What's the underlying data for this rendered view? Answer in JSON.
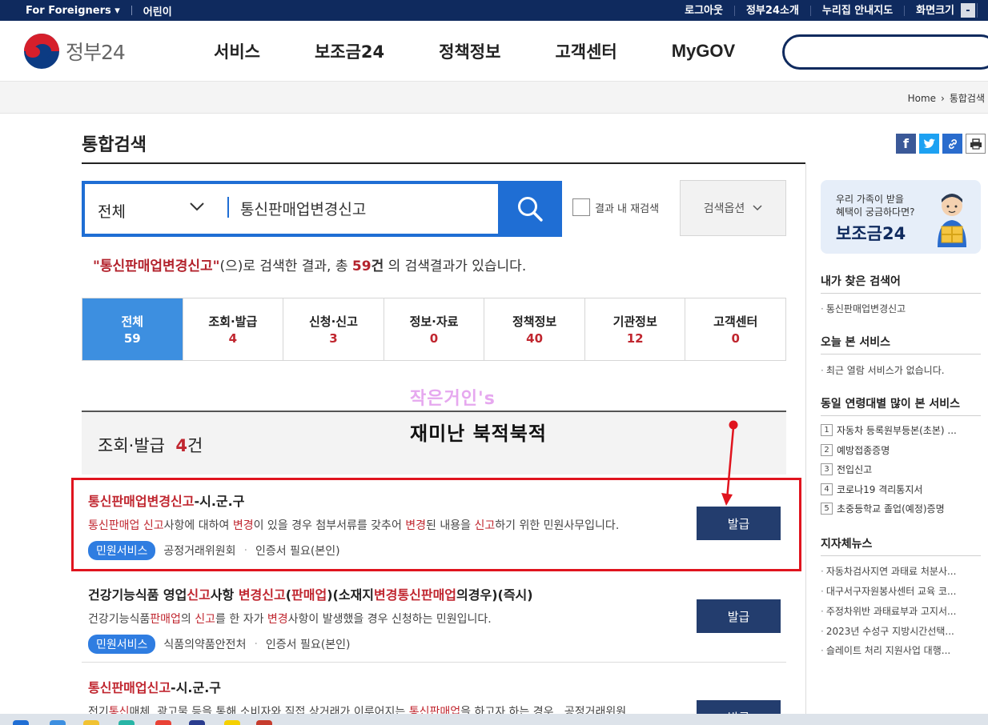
{
  "utility": {
    "for_foreigners": "For Foreigners",
    "kids": "어린이",
    "logout": "로그아웃",
    "about": "정부24소개",
    "sitemap": "누리집 안내지도",
    "fontsize": "화면크기",
    "minus": "-"
  },
  "header": {
    "logo_text": "정부24",
    "nav": [
      "서비스",
      "보조금24",
      "정책정보",
      "고객센터",
      "MyGOV"
    ]
  },
  "breadcrumb": {
    "home": "Home",
    "current": "통합검색"
  },
  "page": {
    "title": "통합검색"
  },
  "search": {
    "scope": "전체",
    "query": "통신판매업변경신고",
    "research_label": "결과 내 재검색",
    "options_label": "검색옵션"
  },
  "summary": {
    "keyword": "\"통신판매업변경신고\"",
    "text1": "(으)로 검색한 결과, 총 ",
    "count": "59",
    "unit": "건",
    "text2": " 의 검색결과가 있습니다."
  },
  "tabs": [
    {
      "label": "전체",
      "count": "59"
    },
    {
      "label": "조회·발급",
      "count": "4"
    },
    {
      "label": "신청·신고",
      "count": "3"
    },
    {
      "label": "정보·자료",
      "count": "0"
    },
    {
      "label": "정책정보",
      "count": "40"
    },
    {
      "label": "기관정보",
      "count": "12"
    },
    {
      "label": "고객센터",
      "count": "0"
    }
  ],
  "watermark": {
    "line1": "작은거인's",
    "line2": "재미난 북적북적"
  },
  "section": {
    "title": "조회·발급",
    "count": "4",
    "unit": "건"
  },
  "results": [
    {
      "title_hl": "통신판매업변경신고",
      "title_rest": "-시.군.구",
      "desc": [
        {
          "t": "통신판매업 신고",
          "h": true
        },
        {
          "t": "사항에 대하여 ",
          "h": false
        },
        {
          "t": "변경",
          "h": true
        },
        {
          "t": "이 있을 경우 첨부서류를 갖추어 ",
          "h": false
        },
        {
          "t": "변경",
          "h": true
        },
        {
          "t": "된 내용을 ",
          "h": false
        },
        {
          "t": "신고",
          "h": true
        },
        {
          "t": "하기 위한 민원사무입니다.",
          "h": false
        }
      ],
      "badge": "민원서비스",
      "org": "공정거래위원회",
      "auth": "인증서 필요(본인)",
      "button": "발급"
    },
    {
      "title_parts": [
        {
          "t": "건강기능식품 영업",
          "h": false
        },
        {
          "t": "신고",
          "h": true
        },
        {
          "t": "사항 ",
          "h": false
        },
        {
          "t": "변경신고",
          "h": true
        },
        {
          "t": "(",
          "h": false
        },
        {
          "t": "판매업",
          "h": true
        },
        {
          "t": ")(소재지",
          "h": false
        },
        {
          "t": "변경통신판매업",
          "h": true
        },
        {
          "t": "의경우)(즉시)",
          "h": false
        }
      ],
      "desc": [
        {
          "t": "건강기능식품",
          "h": false
        },
        {
          "t": "판매업",
          "h": true
        },
        {
          "t": "의 ",
          "h": false
        },
        {
          "t": "신고",
          "h": true
        },
        {
          "t": "를 한 자가 ",
          "h": false
        },
        {
          "t": "변경",
          "h": true
        },
        {
          "t": "사항이 발생했을 경우 신청하는 민원입니다.",
          "h": false
        }
      ],
      "badge": "민원서비스",
      "org": "식품의약품안전처",
      "auth": "인증서 필요(본인)",
      "button": "발급"
    },
    {
      "title_hl": "통신판매업신고",
      "title_rest": "-시.군.구",
      "desc": [
        {
          "t": "전기",
          "h": false
        },
        {
          "t": "통신",
          "h": true
        },
        {
          "t": "매체, 광고물 등을 통해 소비자와 직접 상거래가 이루어지는 ",
          "h": false
        },
        {
          "t": "통신판매업",
          "h": true
        },
        {
          "t": "을 하고자 하는 경우 , 공정거래위원",
          "h": false
        }
      ],
      "button": "발급"
    }
  ],
  "sidebar": {
    "banner_line1": "우리 가족이 받을",
    "banner_line2": "혜택이 궁금하다면?",
    "banner_title": "보조금24",
    "my_searches_title": "내가 찾은 검색어",
    "my_searches": [
      "통신판매업변경신고"
    ],
    "today_title": "오늘 본 서비스",
    "today_items": [
      "최근 열람 서비스가 없습니다."
    ],
    "popular_title": "동일 연령대별 많이 본 서비스",
    "popular": [
      "자동차 등록원부등본(초본) ...",
      "예방접종증명",
      "전입신고",
      "코로나19 격리통지서",
      "초중등학교 졸업(예정)증명"
    ],
    "news_title": "지자체뉴스",
    "news": [
      "자동차검사지연 과태료 처분사...",
      "대구서구자원봉사센터 교육 코...",
      "주정차위반 과태료부과 고지서...",
      "2023년 수성구 지방시간선택...",
      "슬레이트 처리 지원사업 대행..."
    ]
  },
  "colors": {
    "navy": "#0f2a5e",
    "blue": "#1f6ed4",
    "highlight": "#c0262f",
    "annotation": "#e0141e"
  }
}
